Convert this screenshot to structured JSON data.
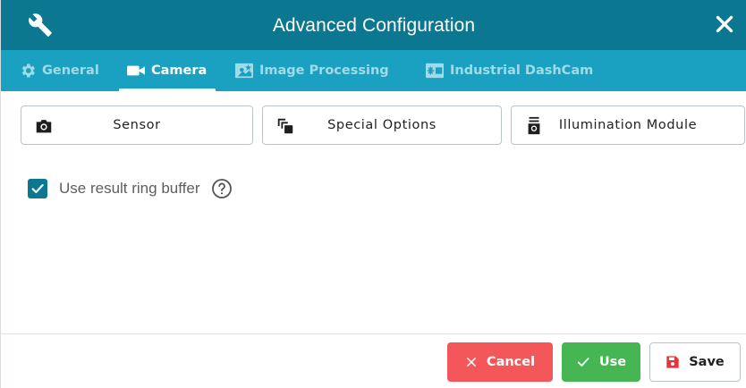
{
  "window": {
    "title": "Advanced Configuration",
    "icons": {
      "left": "wrench-icon",
      "close": "close-icon"
    }
  },
  "tabs": [
    {
      "label": "General",
      "icon": "gear-icon",
      "active": false
    },
    {
      "label": "Camera",
      "icon": "video-camera-icon",
      "active": true
    },
    {
      "label": "Image Processing",
      "icon": "image-processing-icon",
      "active": false
    },
    {
      "label": "Industrial DashCam",
      "icon": "dashcam-icon",
      "active": false
    }
  ],
  "option_buttons": [
    {
      "label": "Sensor",
      "icon": "camera-icon"
    },
    {
      "label": "Special Options",
      "icon": "layers-icon"
    },
    {
      "label": "Illumination Module",
      "icon": "illumination-icon"
    }
  ],
  "settings": {
    "ring_buffer": {
      "label": "Use result ring buffer",
      "checked": true,
      "help_icon": "help-icon"
    }
  },
  "actions": {
    "cancel": "Cancel",
    "use": "Use",
    "save": "Save"
  },
  "colors": {
    "titlebar": "#0b7791",
    "tabbar": "#1aa0c0",
    "cancel": "#f4575a",
    "use": "#46b653"
  }
}
